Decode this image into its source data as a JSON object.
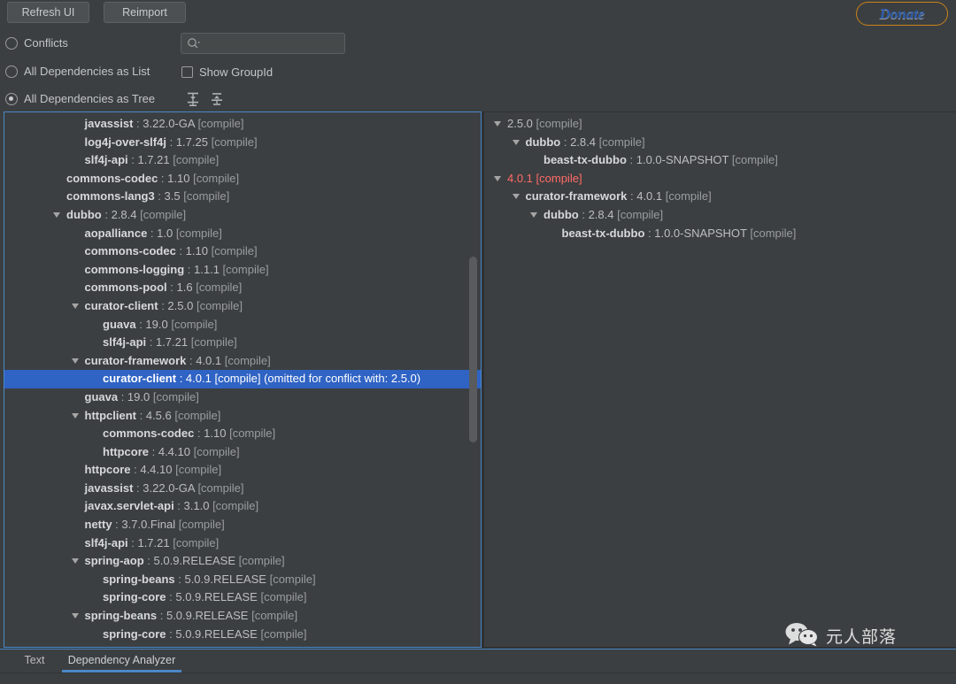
{
  "toolbar": {
    "refresh_label": "Refresh UI",
    "reimport_label": "Reimport",
    "donate_label": "Donate"
  },
  "options": {
    "conflicts_label": "Conflicts",
    "list_label": "All Dependencies as List",
    "tree_label": "All Dependencies as Tree",
    "group_id_label": "Show GroupId",
    "selected": "All Dependencies as Tree",
    "show_group_id_checked": false
  },
  "search": {
    "value": "",
    "placeholder": ""
  },
  "tree_tools": {
    "expand_icon": "expand-all-icon",
    "collapse_icon": "collapse-all-icon"
  },
  "colors": {
    "selection": "#2f63c4",
    "conflict": "#ff6b68",
    "accent": "#4a88c7",
    "panel_bg": "#3c3f41"
  },
  "left_tree": {
    "nodes": [
      {
        "indent": 3,
        "arrow": false,
        "name": "javassist",
        "version": "3.22.0-GA",
        "scope": "[compile]"
      },
      {
        "indent": 3,
        "arrow": false,
        "name": "log4j-over-slf4j",
        "version": "1.7.25",
        "scope": "[compile]"
      },
      {
        "indent": 3,
        "arrow": false,
        "name": "slf4j-api",
        "version": "1.7.21",
        "scope": "[compile]"
      },
      {
        "indent": 2,
        "arrow": false,
        "name": "commons-codec",
        "version": "1.10",
        "scope": "[compile]"
      },
      {
        "indent": 2,
        "arrow": false,
        "name": "commons-lang3",
        "version": "3.5",
        "scope": "[compile]"
      },
      {
        "indent": 2,
        "arrow": true,
        "name": "dubbo",
        "version": "2.8.4",
        "scope": "[compile]"
      },
      {
        "indent": 3,
        "arrow": false,
        "name": "aopalliance",
        "version": "1.0",
        "scope": "[compile]"
      },
      {
        "indent": 3,
        "arrow": false,
        "name": "commons-codec",
        "version": "1.10",
        "scope": "[compile]"
      },
      {
        "indent": 3,
        "arrow": false,
        "name": "commons-logging",
        "version": "1.1.1",
        "scope": "[compile]"
      },
      {
        "indent": 3,
        "arrow": false,
        "name": "commons-pool",
        "version": "1.6",
        "scope": "[compile]"
      },
      {
        "indent": 3,
        "arrow": true,
        "name": "curator-client",
        "version": "2.5.0",
        "scope": "[compile]"
      },
      {
        "indent": 4,
        "arrow": false,
        "name": "guava",
        "version": "19.0",
        "scope": "[compile]"
      },
      {
        "indent": 4,
        "arrow": false,
        "name": "slf4j-api",
        "version": "1.7.21",
        "scope": "[compile]"
      },
      {
        "indent": 3,
        "arrow": true,
        "name": "curator-framework",
        "version": "4.0.1",
        "scope": "[compile]"
      },
      {
        "indent": 4,
        "arrow": false,
        "name": "curator-client",
        "version": "4.0.1",
        "scope": "[compile]",
        "note": "(omitted for conflict with: 2.5.0)",
        "selected": true
      },
      {
        "indent": 3,
        "arrow": false,
        "name": "guava",
        "version": "19.0",
        "scope": "[compile]"
      },
      {
        "indent": 3,
        "arrow": true,
        "name": "httpclient",
        "version": "4.5.6",
        "scope": "[compile]"
      },
      {
        "indent": 4,
        "arrow": false,
        "name": "commons-codec",
        "version": "1.10",
        "scope": "[compile]"
      },
      {
        "indent": 4,
        "arrow": false,
        "name": "httpcore",
        "version": "4.4.10",
        "scope": "[compile]"
      },
      {
        "indent": 3,
        "arrow": false,
        "name": "httpcore",
        "version": "4.4.10",
        "scope": "[compile]"
      },
      {
        "indent": 3,
        "arrow": false,
        "name": "javassist",
        "version": "3.22.0-GA",
        "scope": "[compile]"
      },
      {
        "indent": 3,
        "arrow": false,
        "name": "javax.servlet-api",
        "version": "3.1.0",
        "scope": "[compile]"
      },
      {
        "indent": 3,
        "arrow": false,
        "name": "netty",
        "version": "3.7.0.Final",
        "scope": "[compile]"
      },
      {
        "indent": 3,
        "arrow": false,
        "name": "slf4j-api",
        "version": "1.7.21",
        "scope": "[compile]"
      },
      {
        "indent": 3,
        "arrow": true,
        "name": "spring-aop",
        "version": "5.0.9.RELEASE",
        "scope": "[compile]"
      },
      {
        "indent": 4,
        "arrow": false,
        "name": "spring-beans",
        "version": "5.0.9.RELEASE",
        "scope": "[compile]"
      },
      {
        "indent": 4,
        "arrow": false,
        "name": "spring-core",
        "version": "5.0.9.RELEASE",
        "scope": "[compile]"
      },
      {
        "indent": 3,
        "arrow": true,
        "name": "spring-beans",
        "version": "5.0.9.RELEASE",
        "scope": "[compile]"
      },
      {
        "indent": 4,
        "arrow": false,
        "name": "spring-core",
        "version": "5.0.9.RELEASE",
        "scope": "[compile]"
      }
    ]
  },
  "right_tree": {
    "nodes": [
      {
        "indent": 0,
        "arrow": true,
        "name": "",
        "version": "2.5.0",
        "scope": "[compile]"
      },
      {
        "indent": 1,
        "arrow": true,
        "name": "dubbo",
        "version": "2.8.4",
        "scope": "[compile]"
      },
      {
        "indent": 2,
        "arrow": false,
        "name": "beast-tx-dubbo",
        "version": "1.0.0-SNAPSHOT",
        "scope": "[compile]"
      },
      {
        "indent": 0,
        "arrow": true,
        "name": "",
        "version": "4.0.1",
        "scope": "[compile]",
        "conflict": true
      },
      {
        "indent": 1,
        "arrow": true,
        "name": "curator-framework",
        "version": "4.0.1",
        "scope": "[compile]"
      },
      {
        "indent": 2,
        "arrow": true,
        "name": "dubbo",
        "version": "2.8.4",
        "scope": "[compile]"
      },
      {
        "indent": 3,
        "arrow": false,
        "name": "beast-tx-dubbo",
        "version": "1.0.0-SNAPSHOT",
        "scope": "[compile]"
      }
    ]
  },
  "tabs": {
    "items": [
      {
        "label": "Text",
        "active": false
      },
      {
        "label": "Dependency Analyzer",
        "active": true
      }
    ]
  },
  "watermark": {
    "text": "元人部落",
    "icon": "wechat-icon"
  }
}
